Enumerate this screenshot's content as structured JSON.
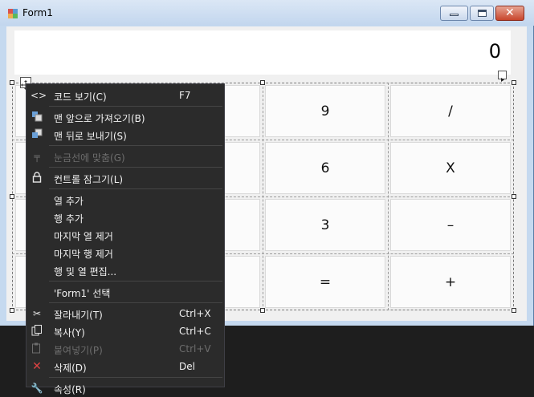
{
  "window": {
    "title": "Form1"
  },
  "display": {
    "value": "0"
  },
  "buttons": [
    {
      "row": 0,
      "col": 2,
      "label": "9"
    },
    {
      "row": 0,
      "col": 3,
      "label": "/"
    },
    {
      "row": 1,
      "col": 2,
      "label": "6"
    },
    {
      "row": 1,
      "col": 3,
      "label": "X"
    },
    {
      "row": 2,
      "col": 2,
      "label": "3"
    },
    {
      "row": 2,
      "col": 3,
      "label": "–"
    },
    {
      "row": 3,
      "col": 2,
      "label": "="
    },
    {
      "row": 3,
      "col": 3,
      "label": "+"
    }
  ],
  "context_menu": {
    "items": [
      {
        "label": "코드 보기(C)",
        "shortcut": "F7",
        "icon": "code-icon",
        "enabled": true
      },
      {
        "label": "맨 앞으로 가져오기(B)",
        "shortcut": "",
        "icon": "bring-to-front-icon",
        "enabled": true
      },
      {
        "label": "맨 뒤로 보내기(S)",
        "shortcut": "",
        "icon": "send-to-back-icon",
        "enabled": true
      },
      {
        "label": "눈금선에 맞춤(G)",
        "shortcut": "",
        "icon": "align-to-grid-icon",
        "enabled": false
      },
      {
        "label": "컨트롤 잠그기(L)",
        "shortcut": "",
        "icon": "lock-icon",
        "enabled": true
      },
      {
        "label": "열 추가",
        "shortcut": "",
        "icon": "",
        "enabled": true
      },
      {
        "label": "행 추가",
        "shortcut": "",
        "icon": "",
        "enabled": true
      },
      {
        "label": "마지막 열 제거",
        "shortcut": "",
        "icon": "",
        "enabled": true
      },
      {
        "label": "마지막 행 제거",
        "shortcut": "",
        "icon": "",
        "enabled": true
      },
      {
        "label": "행 및 열 편집...",
        "shortcut": "",
        "icon": "",
        "enabled": true
      },
      {
        "label": "'Form1' 선택",
        "shortcut": "",
        "icon": "",
        "enabled": true
      },
      {
        "label": "잘라내기(T)",
        "shortcut": "Ctrl+X",
        "icon": "cut-icon",
        "enabled": true
      },
      {
        "label": "복사(Y)",
        "shortcut": "Ctrl+C",
        "icon": "copy-icon",
        "enabled": true
      },
      {
        "label": "붙여넣기(P)",
        "shortcut": "Ctrl+V",
        "icon": "paste-icon",
        "enabled": false
      },
      {
        "label": "삭제(D)",
        "shortcut": "Del",
        "icon": "delete-icon",
        "enabled": true
      },
      {
        "label": "속성(R)",
        "shortcut": "",
        "icon": "properties-icon",
        "enabled": true
      }
    ]
  },
  "colors": {
    "menu_bg": "#2b2b2b",
    "menu_text": "#f1f1f1",
    "disabled_text": "#6d6d6d",
    "delete_icon": "#e04343",
    "close_button": "#c8452c"
  }
}
